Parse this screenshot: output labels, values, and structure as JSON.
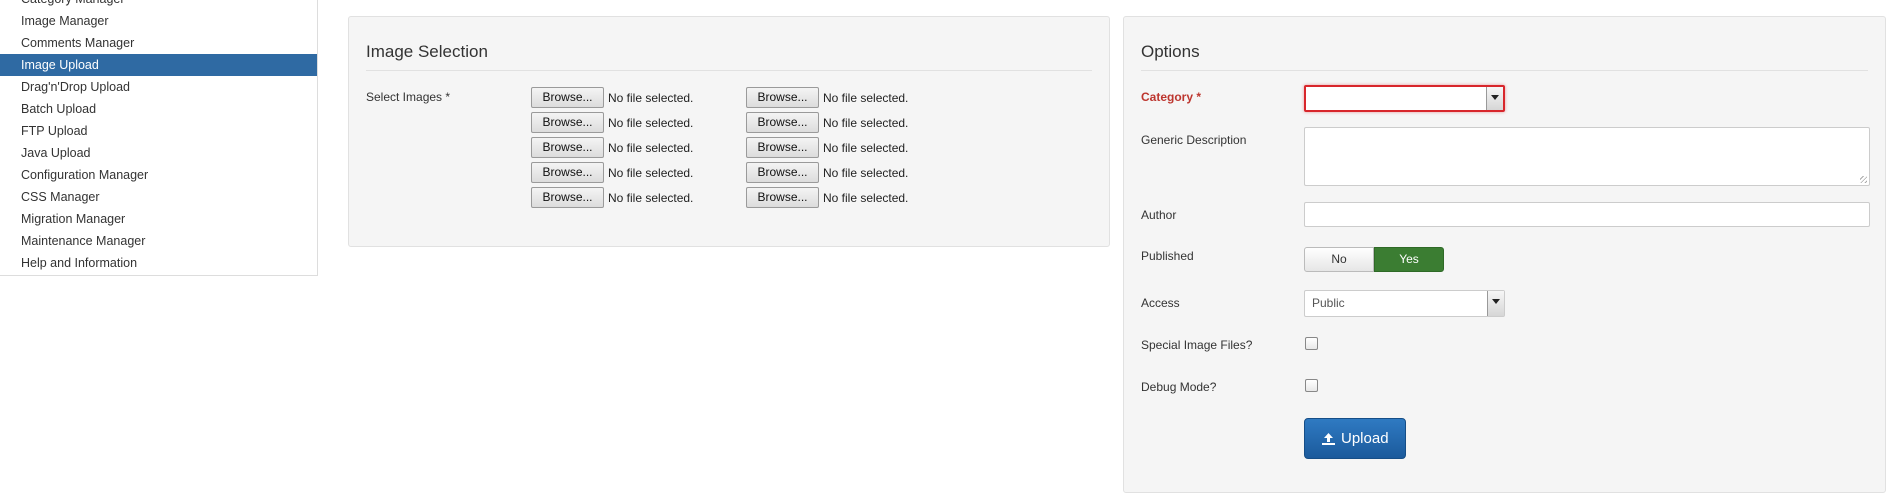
{
  "sidebar": {
    "items": [
      {
        "label": "Category Manager",
        "active": false
      },
      {
        "label": "Image Manager",
        "active": false
      },
      {
        "label": "Comments Manager",
        "active": false
      },
      {
        "label": "Image Upload",
        "active": true
      },
      {
        "label": "Drag'n'Drop Upload",
        "active": false
      },
      {
        "label": "Batch Upload",
        "active": false
      },
      {
        "label": "FTP Upload",
        "active": false
      },
      {
        "label": "Java Upload",
        "active": false
      },
      {
        "label": "Configuration Manager",
        "active": false
      },
      {
        "label": "CSS Manager",
        "active": false
      },
      {
        "label": "Migration Manager",
        "active": false
      },
      {
        "label": "Maintenance Manager",
        "active": false
      },
      {
        "label": "Help and Information",
        "active": false
      }
    ]
  },
  "image_selection": {
    "title": "Image Selection",
    "select_label": "Select Images *",
    "browse_label": "Browse...",
    "no_file_text": "No file selected."
  },
  "options": {
    "title": "Options",
    "category": {
      "label": "Category *",
      "value": ""
    },
    "generic_description": {
      "label": "Generic Description",
      "value": ""
    },
    "author": {
      "label": "Author",
      "value": ""
    },
    "published": {
      "label": "Published",
      "no": "No",
      "yes": "Yes",
      "selected": "Yes"
    },
    "access": {
      "label": "Access",
      "value": "Public"
    },
    "special_image_files": {
      "label": "Special Image Files?",
      "checked": false
    },
    "debug_mode": {
      "label": "Debug Mode?",
      "checked": false
    },
    "upload_label": "Upload"
  },
  "colors": {
    "active_sidebar": "#2f6aa3",
    "required_label": "#bd362f",
    "invalid_border": "#d8262b",
    "published_yes": "#3b7d32",
    "upload_button": "#1f63a8"
  },
  "icons": {
    "upload": "upload-icon",
    "select_arrow": "chevron-down-icon",
    "resize_grip": "resize-grip-icon"
  }
}
